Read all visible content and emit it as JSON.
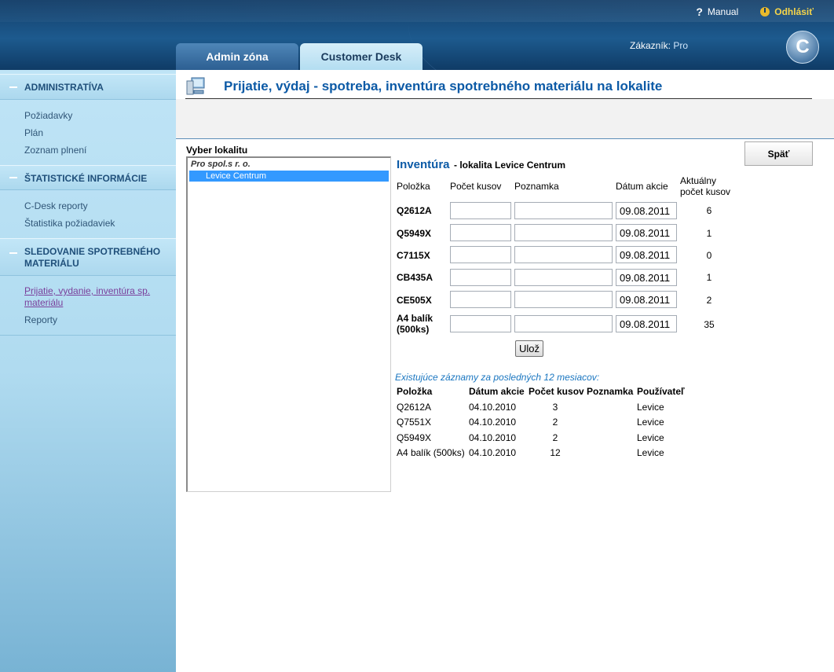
{
  "header": {
    "manual_label": "Manual",
    "logout_label": "Odhlásiť",
    "tabs": [
      {
        "label": "Admin zóna"
      },
      {
        "label": "Customer Desk"
      }
    ],
    "customer_label": "Zákazník:",
    "customer_value": "Pro",
    "logo_letter": "C"
  },
  "sidebar": {
    "sections": [
      {
        "title": "ADMINISTRATÍVA",
        "items": [
          "Požiadavky",
          "Plán",
          "Zoznam plnení"
        ]
      },
      {
        "title": "ŠTATISTICKÉ INFORMÁCIE",
        "items": [
          "C-Desk reporty",
          "Štatistika požiadaviek"
        ]
      },
      {
        "title_line1": "SLEDOVANIE SPOTREBNÉHO",
        "title_line2": "MATERIÁLU",
        "items_active_line1": "Prijatie, vydanie, inventúra sp.",
        "items_active_line2": "materiálu",
        "items": [
          "Reporty"
        ]
      }
    ]
  },
  "page": {
    "title": "Prijatie, výdaj - spotreba, inventúra spotrebného materiálu na lokalite",
    "back_label": "Späť",
    "location_label": "Vyber lokalitu",
    "tree": {
      "org": "Pro spol.s r. o.",
      "selected": "Levice Centrum"
    }
  },
  "inventory": {
    "title": "Inventúra",
    "subtitle": "- lokalita Levice Centrum",
    "columns": {
      "item": "Položka",
      "count": "Počet kusov",
      "note": "Poznamka",
      "date": "Dátum akcie",
      "actual_line1": "Aktuálny",
      "actual_line2": "počet kusov"
    },
    "rows": [
      {
        "code": "Q2612A",
        "date": "09.08.2011",
        "qty": "6"
      },
      {
        "code": "Q5949X",
        "date": "09.08.2011",
        "qty": "1"
      },
      {
        "code": "C7115X",
        "date": "09.08.2011",
        "qty": "0"
      },
      {
        "code": "CB435A",
        "date": "09.08.2011",
        "qty": "1"
      },
      {
        "code": "CE505X",
        "date": "09.08.2011",
        "qty": "2"
      },
      {
        "code_line1": "A4 balík",
        "code_line2": "(500ks)",
        "date": "09.08.2011",
        "qty": "35"
      }
    ],
    "save_label": "Ulož"
  },
  "history": {
    "title": "Existujúce záznamy za posledných 12 mesiacov:",
    "columns": {
      "item": "Položka",
      "date": "Dátum akcie",
      "count": "Počet kusov",
      "note": "Poznamka",
      "user": "Používateľ"
    },
    "rows": [
      {
        "item": "Q2612A",
        "date": "04.10.2010",
        "count": "3",
        "user": "Levice"
      },
      {
        "item": "Q7551X",
        "date": "04.10.2010",
        "count": "2",
        "user": "Levice"
      },
      {
        "item": "Q5949X",
        "date": "04.10.2010",
        "count": "2",
        "user": "Levice"
      },
      {
        "item": "A4 balík (500ks)",
        "date": "04.10.2010",
        "count": "12",
        "user": "Levice"
      }
    ]
  }
}
